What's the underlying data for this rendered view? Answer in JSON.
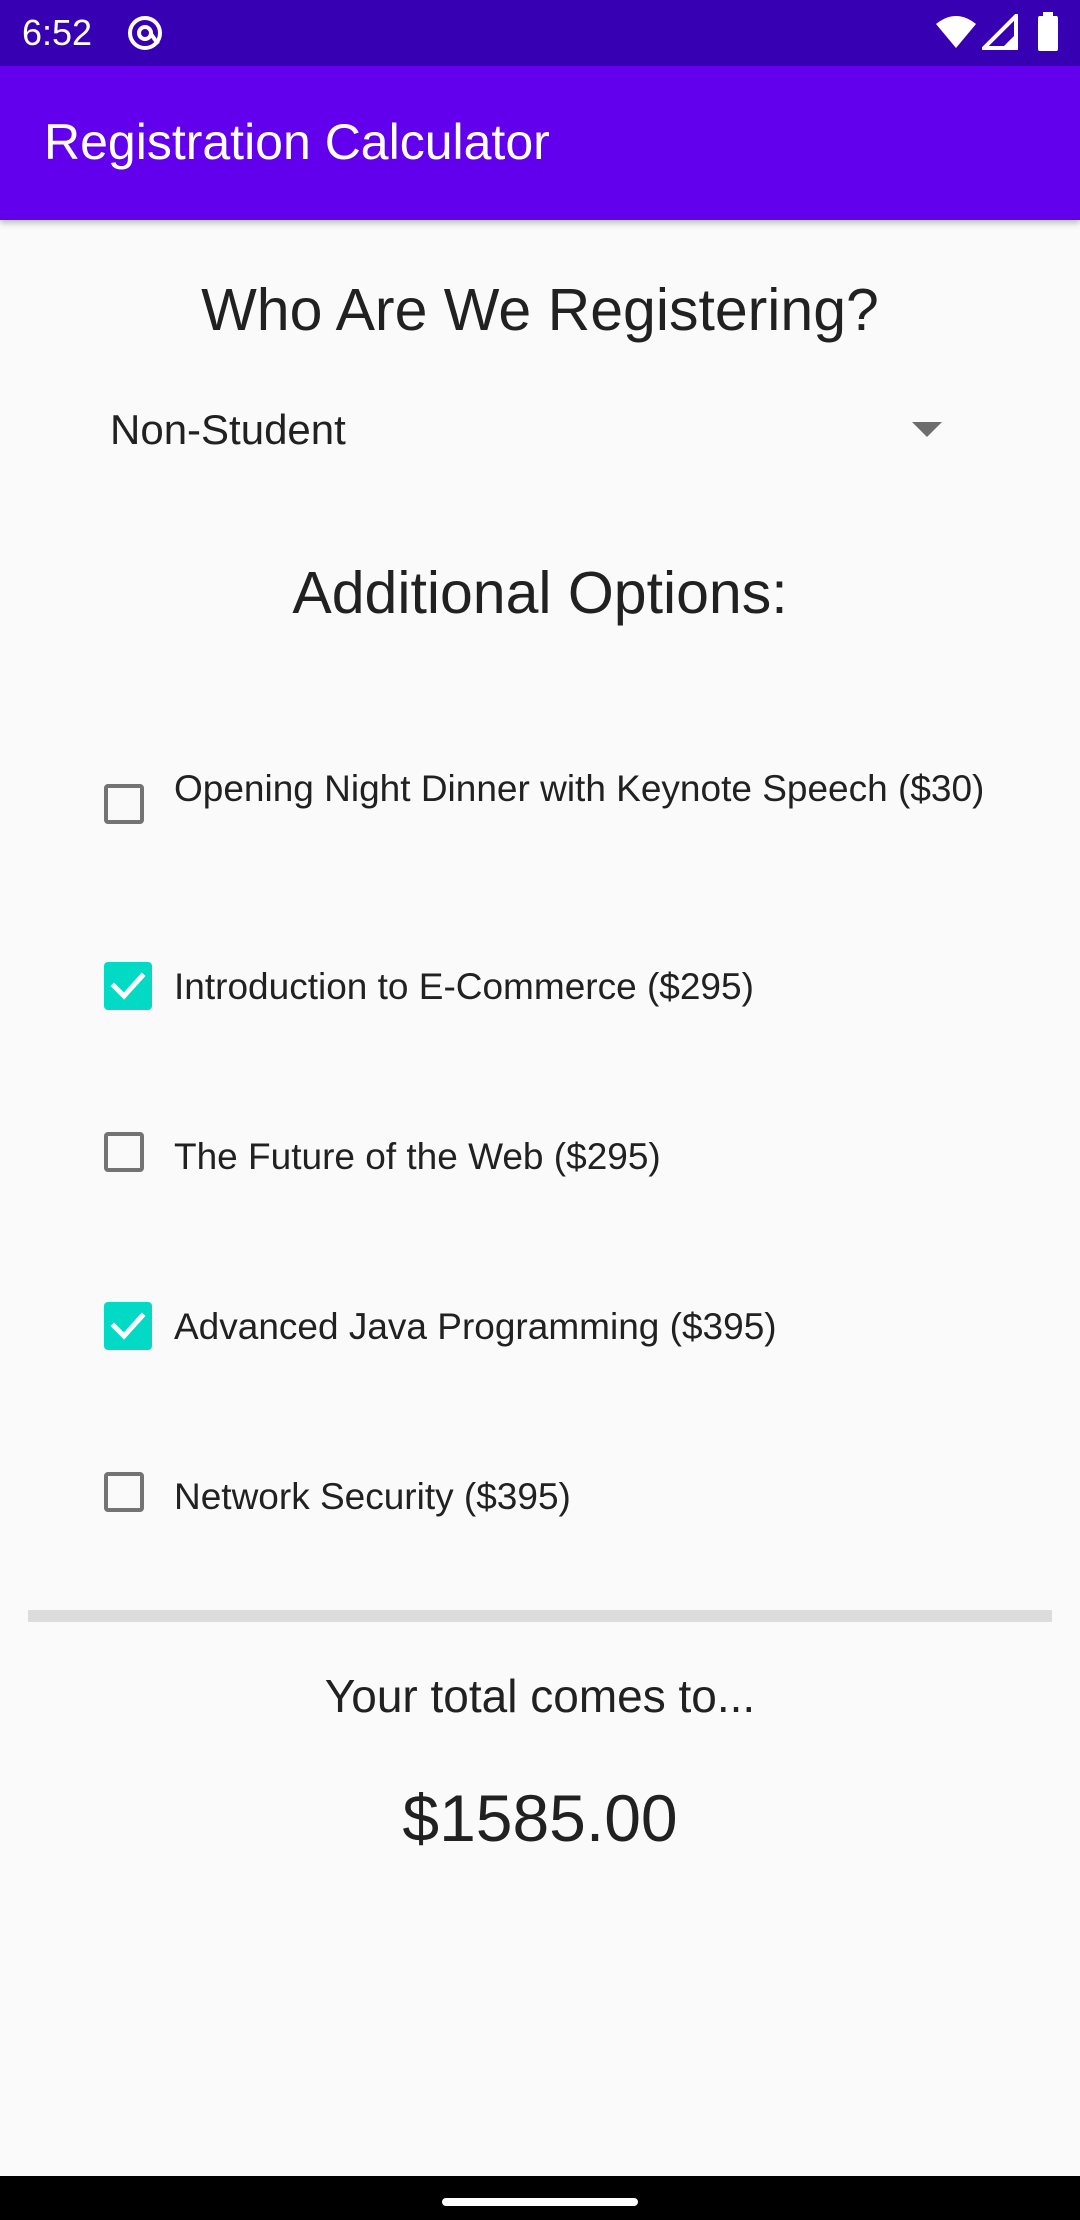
{
  "status_bar": {
    "time": "6:52",
    "app_icon": "at-sign-icon",
    "icons": [
      "wifi-icon",
      "signal-icon",
      "battery-icon"
    ]
  },
  "app_bar": {
    "title": "Registration Calculator"
  },
  "main": {
    "who_heading": "Who Are We Registering?",
    "registrant_type": {
      "selected": "Non-Student"
    },
    "options_heading": "Additional Options:",
    "options": [
      {
        "label": "Opening Night Dinner with Keynote Speech ($30)",
        "checked": false
      },
      {
        "label": "Introduction to E-Commerce ($295)",
        "checked": true
      },
      {
        "label": "The Future of the Web ($295)",
        "checked": false
      },
      {
        "label": "Advanced Java Programming ($395)",
        "checked": true
      },
      {
        "label": "Network Security ($395)",
        "checked": false
      }
    ],
    "total_label": "Your total comes to...",
    "total_value": "$1585.00"
  },
  "colors": {
    "status_bar": "#3700b3",
    "app_bar": "#6200ee",
    "checkbox_checked": "#03dac5",
    "checkbox_unchecked_border": "#737373",
    "background": "#fafafa"
  }
}
